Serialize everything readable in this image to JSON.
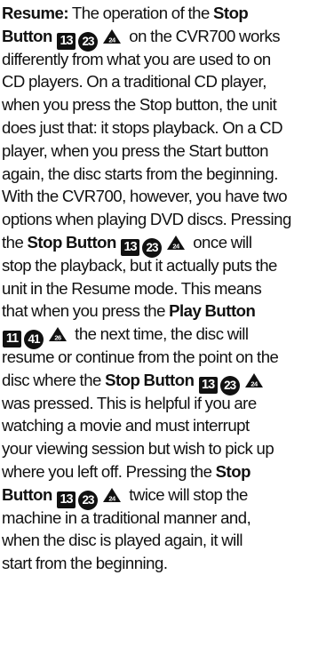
{
  "lines": [
    [
      {
        "t": "text",
        "b": true,
        "v": "Resume:"
      },
      {
        "t": "text",
        "v": " The operation of the "
      },
      {
        "t": "text",
        "b": true,
        "v": "Stop"
      }
    ],
    [
      {
        "t": "text",
        "b": true,
        "v": "Button "
      },
      {
        "t": "sq",
        "v": "13"
      },
      {
        "t": "cir",
        "v": "23"
      },
      {
        "t": "tri",
        "v": "24"
      },
      {
        "t": "text",
        "v": " on the CVR700 works"
      }
    ],
    [
      {
        "t": "text",
        "v": "differently from what you are used to on"
      }
    ],
    [
      {
        "t": "text",
        "v": "CD players. On a traditional CD player,"
      }
    ],
    [
      {
        "t": "text",
        "v": "when you press the Stop button, the unit"
      }
    ],
    [
      {
        "t": "text",
        "v": "does just that: it stops playback. On a CD"
      }
    ],
    [
      {
        "t": "text",
        "v": "player, when you press the Start button"
      }
    ],
    [
      {
        "t": "text",
        "v": "again, the disc starts from the beginning."
      }
    ],
    [
      {
        "t": "text",
        "v": "With the CVR700, however, you have two"
      }
    ],
    [
      {
        "t": "text",
        "v": "options when playing DVD discs. Pressing"
      }
    ],
    [
      {
        "t": "text",
        "v": "the "
      },
      {
        "t": "text",
        "b": true,
        "v": "Stop Button "
      },
      {
        "t": "sq",
        "v": "13"
      },
      {
        "t": "cir",
        "v": "23"
      },
      {
        "t": "tri",
        "v": "24"
      },
      {
        "t": "text",
        "v": " once will"
      }
    ],
    [
      {
        "t": "text",
        "v": "stop the playback, but it actually puts the"
      }
    ],
    [
      {
        "t": "text",
        "v": "unit in the Resume mode. This means"
      }
    ],
    [
      {
        "t": "text",
        "v": "that when you press the "
      },
      {
        "t": "text",
        "b": true,
        "v": "Play Button"
      }
    ],
    [
      {
        "t": "sq",
        "v": "11"
      },
      {
        "t": "cir",
        "v": "41"
      },
      {
        "t": "tri",
        "v": "26"
      },
      {
        "t": "text",
        "v": " the next time, the disc will"
      }
    ],
    [
      {
        "t": "text",
        "v": "resume or continue from the point on the"
      }
    ],
    [
      {
        "t": "text",
        "v": "disc where the "
      },
      {
        "t": "text",
        "b": true,
        "v": "Stop Button "
      },
      {
        "t": "sq",
        "v": "13"
      },
      {
        "t": "cir",
        "v": "23"
      },
      {
        "t": "tri",
        "v": "24"
      }
    ],
    [
      {
        "t": "text",
        "v": "was pressed. This is helpful if you are"
      }
    ],
    [
      {
        "t": "text",
        "v": "watching a movie and must interrupt"
      }
    ],
    [
      {
        "t": "text",
        "v": "your viewing session but wish to pick up"
      }
    ],
    [
      {
        "t": "text",
        "v": "where you left off. Pressing the "
      },
      {
        "t": "text",
        "b": true,
        "v": "Stop"
      }
    ],
    [
      {
        "t": "text",
        "b": true,
        "v": "Button "
      },
      {
        "t": "sq",
        "v": "13"
      },
      {
        "t": "cir",
        "v": "23"
      },
      {
        "t": "tri",
        "v": "24"
      },
      {
        "t": "text",
        "v": " twice will stop the"
      }
    ],
    [
      {
        "t": "text",
        "v": "machine in a traditional manner and,"
      }
    ],
    [
      {
        "t": "text",
        "v": "when the disc is played again, it will"
      }
    ],
    [
      {
        "t": "text",
        "v": "start from the beginning."
      }
    ]
  ]
}
